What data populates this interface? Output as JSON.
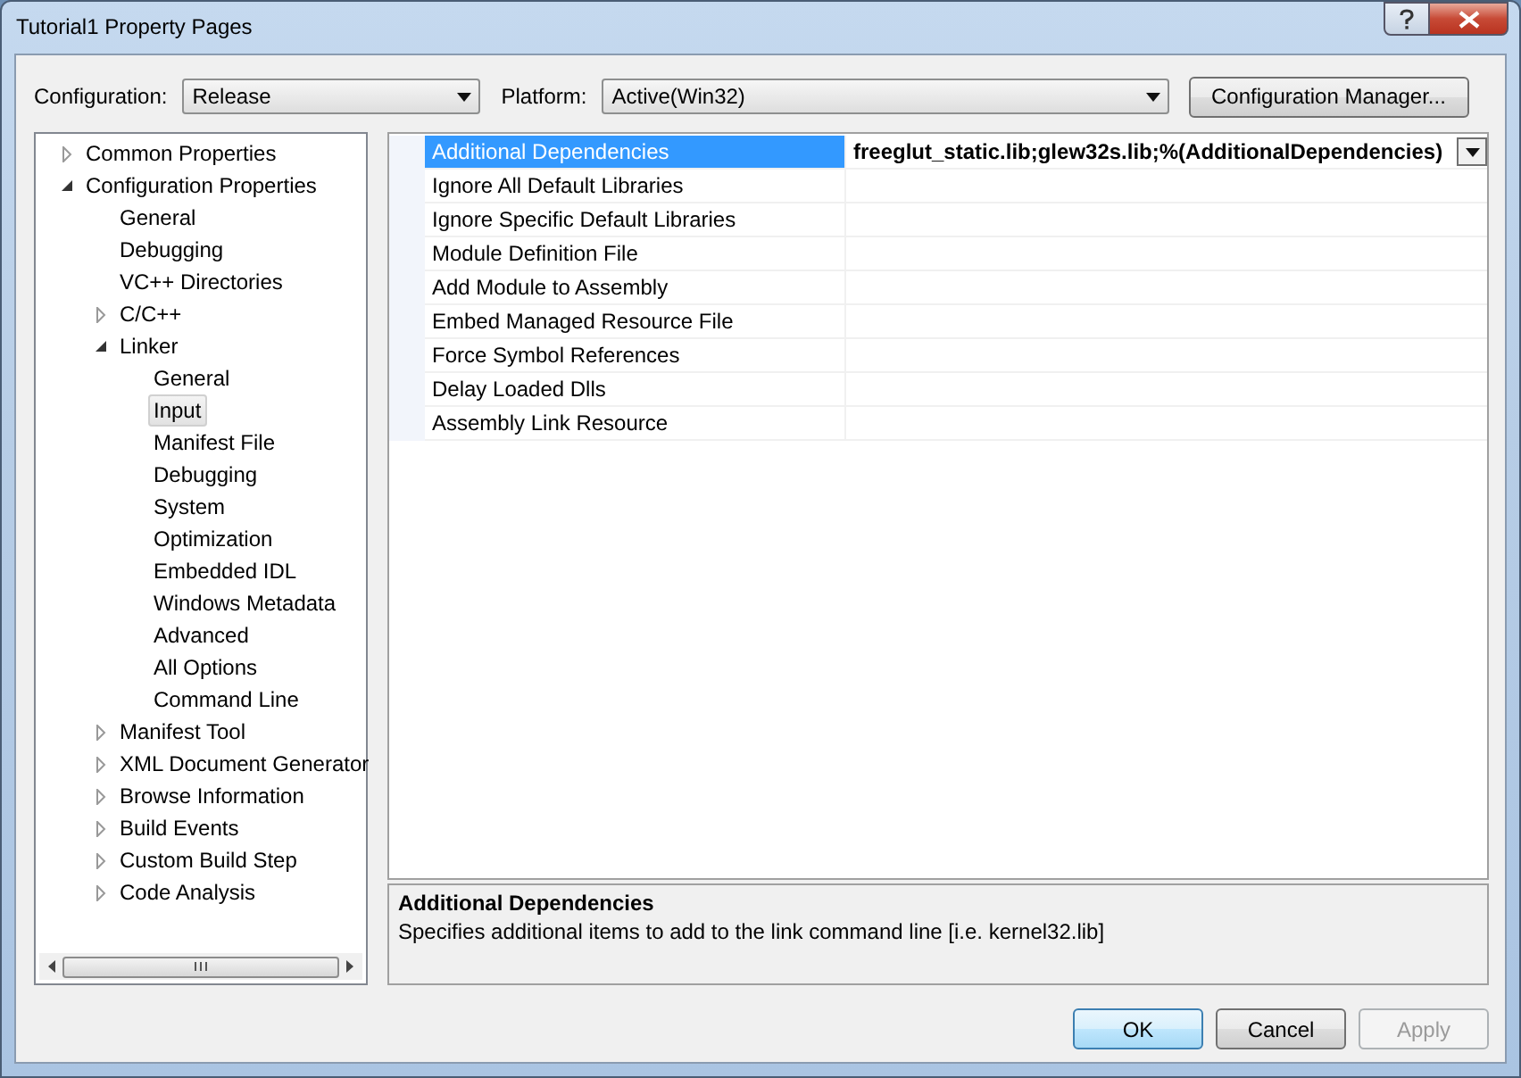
{
  "window": {
    "title": "Tutorial1 Property Pages"
  },
  "configuration": {
    "label": "Configuration:",
    "value": "Release"
  },
  "platform": {
    "label": "Platform:",
    "value": "Active(Win32)"
  },
  "configuration_manager_button": "Configuration Manager...",
  "tree": [
    {
      "label": "Common Properties",
      "expanded": false,
      "selected": false
    },
    {
      "label": "Configuration Properties",
      "expanded": true,
      "selected": false,
      "children": [
        {
          "label": "General",
          "selected": false
        },
        {
          "label": "Debugging",
          "selected": false
        },
        {
          "label": "VC++ Directories",
          "selected": false
        },
        {
          "label": "C/C++",
          "expanded": false,
          "selected": false
        },
        {
          "label": "Linker",
          "expanded": true,
          "selected": false,
          "children": [
            {
              "label": "General",
              "selected": false
            },
            {
              "label": "Input",
              "selected": true
            },
            {
              "label": "Manifest File",
              "selected": false
            },
            {
              "label": "Debugging",
              "selected": false
            },
            {
              "label": "System",
              "selected": false
            },
            {
              "label": "Optimization",
              "selected": false
            },
            {
              "label": "Embedded IDL",
              "selected": false
            },
            {
              "label": "Windows Metadata",
              "selected": false
            },
            {
              "label": "Advanced",
              "selected": false
            },
            {
              "label": "All Options",
              "selected": false
            },
            {
              "label": "Command Line",
              "selected": false
            }
          ]
        },
        {
          "label": "Manifest Tool",
          "expanded": false,
          "selected": false
        },
        {
          "label": "XML Document Generator",
          "expanded": false,
          "selected": false
        },
        {
          "label": "Browse Information",
          "expanded": false,
          "selected": false
        },
        {
          "label": "Build Events",
          "expanded": false,
          "selected": false
        },
        {
          "label": "Custom Build Step",
          "expanded": false,
          "selected": false
        },
        {
          "label": "Code Analysis",
          "expanded": false,
          "selected": false
        }
      ]
    }
  ],
  "properties": [
    {
      "name": "Additional Dependencies",
      "value": "freeglut_static.lib;glew32s.lib;%(AdditionalDependencies)",
      "selected": true
    },
    {
      "name": "Ignore All Default Libraries",
      "selected": false
    },
    {
      "name": "Ignore Specific Default Libraries",
      "selected": false
    },
    {
      "name": "Module Definition File",
      "selected": false
    },
    {
      "name": "Add Module to Assembly",
      "selected": false
    },
    {
      "name": "Embed Managed Resource File",
      "selected": false
    },
    {
      "name": "Force Symbol References",
      "selected": false
    },
    {
      "name": "Delay Loaded Dlls",
      "selected": false
    },
    {
      "name": "Assembly Link Resource",
      "selected": false
    }
  ],
  "description": {
    "title": "Additional Dependencies",
    "text": "Specifies additional items to add to the link command line [i.e. kernel32.lib]"
  },
  "buttons": [
    {
      "label": "OK",
      "default": true,
      "disabled": false
    },
    {
      "label": "Cancel",
      "default": false,
      "disabled": false
    },
    {
      "label": "Apply",
      "default": false,
      "disabled": true
    }
  ]
}
